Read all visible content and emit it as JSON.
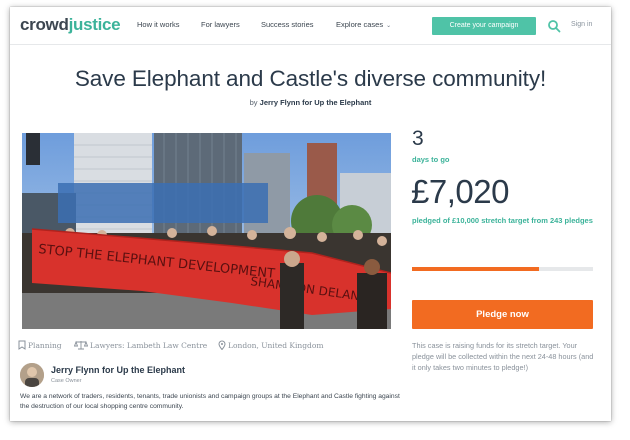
{
  "header": {
    "logo_crowd": "crowd",
    "logo_justice": "justice",
    "nav": {
      "how_it_works": "How it works",
      "for_lawyers": "For lawyers",
      "success_stories": "Success stories",
      "explore_cases": "Explore cases"
    },
    "create_campaign": "Create your campaign",
    "sign_in": "Sign in",
    "search_icon": "search-icon"
  },
  "campaign": {
    "title": "Save Elephant and Castle's diverse community!",
    "by": "by",
    "author": "Jerry Flynn for Up the Elephant",
    "photo_banner_text": "STOP THE ELEPHANT DEVELOPMENT",
    "photo_banner_text2": "SHAME ON DELANCEY",
    "tags": {
      "category": "Planning",
      "lawyers": "Lawyers: Lambeth Law Centre",
      "location": "London, United Kingdom"
    }
  },
  "owner": {
    "name": "Jerry Flynn for Up the Elephant",
    "role": "Case Owner",
    "description": "We are a network of traders, residents, tenants, trade unionists and campaign groups at the Elephant and Castle fighting against the destruction of our local shopping centre community."
  },
  "stats": {
    "days_left": "3",
    "days_label": "days to go",
    "amount": "£7,020",
    "pledged_text": "pledged of £10,000 stretch target from 243 pledges",
    "progress_fraction": 0.702
  },
  "pledge_button": "Pledge now",
  "side_note": "This case is raising funds for its stretch target. Your pledge will be collected within the next 24-48 hours (and it only takes two minutes to pledge!)",
  "colors": {
    "accent_green": "#3cb39a",
    "cta_green": "#4fc3a7",
    "pledge_orange": "#f26b21",
    "text_dark": "#2b3a4a"
  }
}
